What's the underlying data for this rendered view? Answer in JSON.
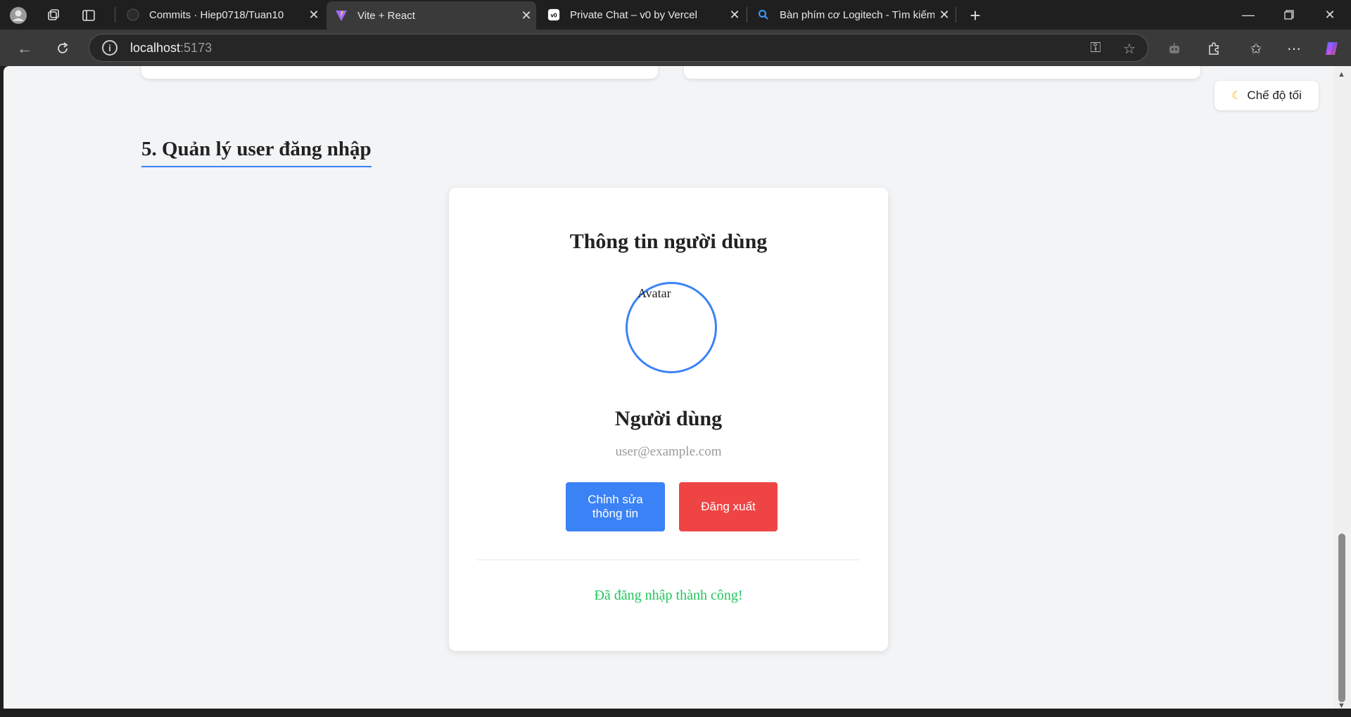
{
  "browser": {
    "tabs": [
      {
        "title": "Commits · Hiep0718/Tuan10",
        "icon": "github-icon"
      },
      {
        "title": "Vite + React",
        "icon": "vite-icon",
        "active": true
      },
      {
        "title": "Private Chat – v0 by Vercel",
        "icon": "v0-icon"
      },
      {
        "title": "Bàn phím cơ Logitech - Tìm kiếm",
        "icon": "search-icon"
      }
    ],
    "address": {
      "host": "localhost",
      "port": ":5173"
    }
  },
  "page": {
    "dark_mode_label": "Chế độ tối",
    "section_title": "5. Quản lý user đăng nhập",
    "profile": {
      "title": "Thông tin người dùng",
      "avatar_alt": "Avatar",
      "name": "Người dùng",
      "email": "user@example.com",
      "edit_button": "Chỉnh sửa thông tin",
      "logout_button": "Đăng xuất",
      "status": "Đã đăng nhập thành công!"
    }
  },
  "colors": {
    "accent": "#3b82f6",
    "danger": "#ef4444",
    "success": "#22c55e",
    "page_bg": "#f3f4f6"
  }
}
